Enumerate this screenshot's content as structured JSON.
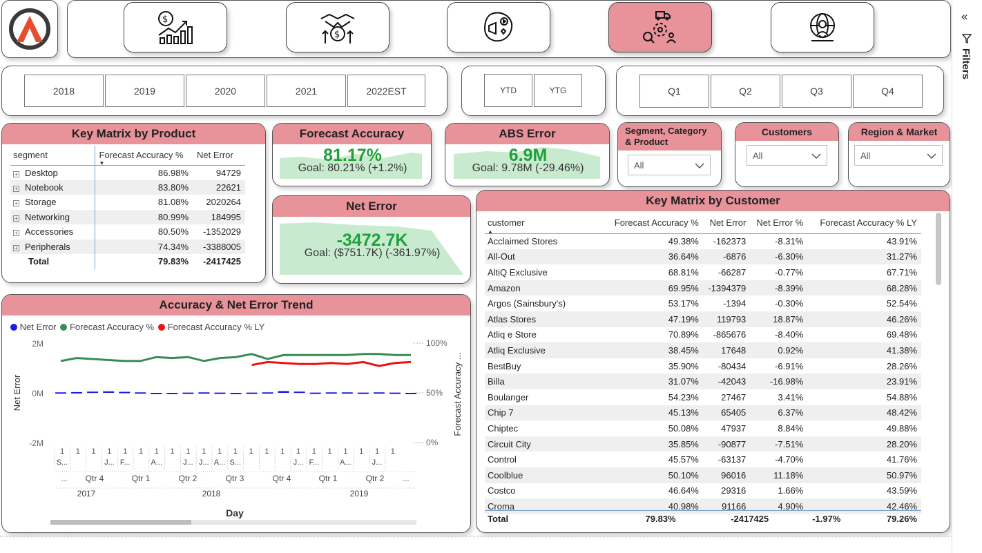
{
  "nav": {
    "logo_letter": "A"
  },
  "years": [
    "2018",
    "2019",
    "2020",
    "2021",
    "2022EST"
  ],
  "ytd": [
    "YTD",
    "YTG"
  ],
  "quarters": [
    "Q1",
    "Q2",
    "Q3",
    "Q4"
  ],
  "product": {
    "title": "Key Matrix by Product",
    "headers": [
      "segment",
      "Forecast Accuracy %",
      "Net Error"
    ],
    "rows": [
      {
        "name": "Desktop",
        "fa": "86.98%",
        "ne": "94729"
      },
      {
        "name": "Notebook",
        "fa": "83.80%",
        "ne": "22621"
      },
      {
        "name": "Storage",
        "fa": "81.08%",
        "ne": "2020264"
      },
      {
        "name": "Networking",
        "fa": "80.99%",
        "ne": "184995"
      },
      {
        "name": "Accessories",
        "fa": "80.50%",
        "ne": "-1352029"
      },
      {
        "name": "Peripherals",
        "fa": "74.34%",
        "ne": "-3388005"
      }
    ],
    "total": {
      "name": "Total",
      "fa": "79.83%",
      "ne": "-2417425"
    }
  },
  "kpi_fa": {
    "title": "Forecast Accuracy",
    "value": "81.17%",
    "goal": "Goal: 80.21% (+1.2%)"
  },
  "kpi_abs": {
    "title": "ABS Error",
    "value": "6.9M",
    "goal": "Goal: 9.78M (-29.46%)"
  },
  "kpi_ne": {
    "title": "Net Error",
    "value": "-3472.7K",
    "goal": "Goal: ($751.7K) (-361.97%)"
  },
  "filters": {
    "segment": {
      "title_line1": "Segment, Category",
      "title_line2": "& Product",
      "value": "All"
    },
    "customers": {
      "title": "Customers",
      "value": "All"
    },
    "region": {
      "title": "Region & Market",
      "value": "All"
    }
  },
  "customer": {
    "title": "Key Matrix by Customer",
    "headers": [
      "customer",
      "Forecast Accuracy %",
      "Net Error",
      "Net Error %",
      "Forecast Accuracy % LY"
    ],
    "rows": [
      [
        "Acclaimed Stores",
        "49.38%",
        "-162373",
        "-8.31%",
        "43.91%"
      ],
      [
        "All-Out",
        "36.64%",
        "-6876",
        "-6.30%",
        "31.27%"
      ],
      [
        "AltiQ Exclusive",
        "68.81%",
        "-66287",
        "-0.77%",
        "67.71%"
      ],
      [
        "Amazon",
        "69.95%",
        "-1394379",
        "-8.39%",
        "68.28%"
      ],
      [
        "Argos (Sainsbury's)",
        "53.17%",
        "-1394",
        "-0.30%",
        "52.54%"
      ],
      [
        "Atlas Stores",
        "47.19%",
        "119793",
        "18.87%",
        "46.26%"
      ],
      [
        "Atliq e Store",
        "70.89%",
        "-865676",
        "-8.40%",
        "69.48%"
      ],
      [
        "Atliq Exclusive",
        "38.45%",
        "17648",
        "0.92%",
        "41.38%"
      ],
      [
        "BestBuy",
        "35.90%",
        "-80434",
        "-6.91%",
        "28.26%"
      ],
      [
        "Billa",
        "31.07%",
        "-42043",
        "-16.98%",
        "23.91%"
      ],
      [
        "Boulanger",
        "54.23%",
        "27467",
        "3.41%",
        "54.88%"
      ],
      [
        "Chip 7",
        "45.13%",
        "65405",
        "6.37%",
        "48.42%"
      ],
      [
        "Chiptec",
        "50.08%",
        "47937",
        "8.84%",
        "49.88%"
      ],
      [
        "Circuit City",
        "35.85%",
        "-90877",
        "-7.51%",
        "28.20%"
      ],
      [
        "Control",
        "45.57%",
        "-63137",
        "-4.70%",
        "41.76%"
      ],
      [
        "Coolblue",
        "50.10%",
        "96016",
        "11.18%",
        "50.97%"
      ],
      [
        "Costco",
        "46.64%",
        "29316",
        "1.66%",
        "43.59%"
      ],
      [
        "Croma",
        "40.98%",
        "91166",
        "4.90%",
        "42.46%"
      ]
    ],
    "total": [
      "Total",
      "79.83%",
      "-2417425",
      "-1.97%",
      "79.26%"
    ]
  },
  "trend": {
    "title": "Accuracy & Net Error Trend",
    "legend": [
      "Net Error",
      "Forecast Accuracy %",
      "Forecast Accuracy % LY"
    ],
    "colors": {
      "net_error": "#1a1aee",
      "fa": "#3a8a55",
      "fa_ly": "#ee1111"
    },
    "y_left_ticks": [
      "2M",
      "0M",
      "-2M"
    ],
    "y_right_ticks": [
      "100%",
      "50%",
      "0%"
    ],
    "y_left_label": "Net Error",
    "y_right_label": "Forecast Accuracy ...",
    "x_label": "Day",
    "x_month_labels": [
      "S...",
      "",
      "",
      "J...",
      "F...",
      "",
      "A...",
      "",
      "J...",
      "J...",
      "A...",
      "S...",
      "",
      "",
      "",
      "J...",
      "F...",
      "",
      "A...",
      "",
      "J...",
      ""
    ],
    "x_quarters": [
      "Qtr 4",
      "Qtr 1",
      "Qtr 2",
      "Qtr 3",
      "Qtr 4",
      "Qtr 1",
      "Qtr 2"
    ],
    "x_years": [
      "2017",
      "2018",
      "2019"
    ],
    "x_day_label": "1",
    "x_ellipsis": "..."
  },
  "chart_data": {
    "type": "line",
    "x": [
      "2017-09",
      "2017-10",
      "2017-11",
      "2017-12",
      "2018-01",
      "2018-02",
      "2018-03",
      "2018-04",
      "2018-05",
      "2018-06",
      "2018-07",
      "2018-08",
      "2018-09",
      "2018-10",
      "2018-11",
      "2018-12",
      "2019-01",
      "2019-02",
      "2019-03",
      "2019-04",
      "2019-05",
      "2019-06",
      "2019-07"
    ],
    "series": [
      {
        "name": "Forecast Accuracy %",
        "axis": "right",
        "values": [
          82,
          85,
          84,
          83,
          82,
          82,
          86,
          85,
          86,
          82,
          85,
          86,
          89,
          84,
          88,
          88,
          88,
          88,
          88,
          89,
          89,
          88,
          88
        ]
      },
      {
        "name": "Forecast Accuracy % LY",
        "axis": "right",
        "values": [
          null,
          null,
          null,
          null,
          null,
          null,
          null,
          null,
          null,
          null,
          null,
          null,
          78,
          81,
          80,
          79,
          79,
          80,
          79,
          81,
          77,
          80,
          81
        ]
      },
      {
        "name": "Net Error",
        "axis": "left",
        "values": [
          0.02,
          0.03,
          0.05,
          0.06,
          0.04,
          0.02,
          -0.01,
          0.0,
          0.01,
          0.02,
          0.01,
          0.0,
          0.01,
          0.02,
          0.07,
          0.05,
          0.01,
          0.02,
          0.02,
          0.01,
          0.02,
          0.01,
          0.0
        ]
      }
    ],
    "title": "Accuracy & Net Error Trend",
    "xlabel": "Day",
    "ylabel_left": "Net Error",
    "ylabel_right": "Forecast Accuracy ...",
    "ylim_left": [
      -2,
      2
    ],
    "ylim_right": [
      0,
      100
    ],
    "legend_position": "top-left",
    "grid": false
  },
  "sidebar": {
    "label": "Filters"
  }
}
